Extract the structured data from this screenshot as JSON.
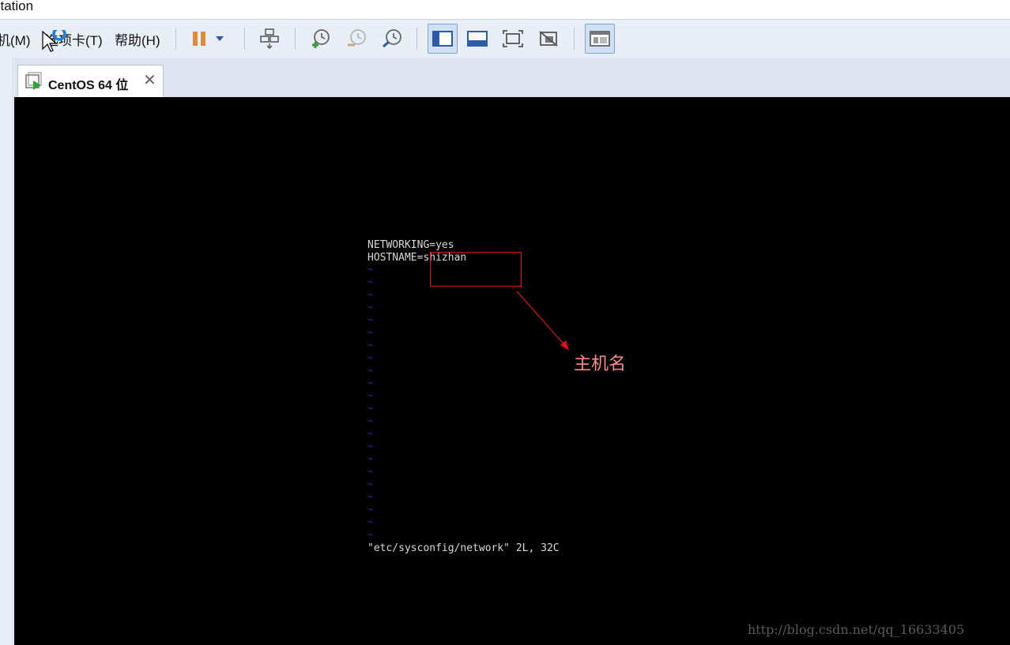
{
  "window": {
    "title": "station"
  },
  "menu": {
    "items": [
      {
        "label": "机(M)"
      },
      {
        "label": "选项卡(T)"
      },
      {
        "label": "帮助(H)"
      }
    ]
  },
  "toolbar": {
    "icons": [
      "pause-icon",
      "dropdown-arrow-icon",
      "send-ctrl-alt-del-icon",
      "snapshot-icon",
      "revert-snapshot-icon",
      "snapshot-manager-icon",
      "console-view-icon",
      "thumbnail-bar-icon",
      "fullscreen-icon",
      "unity-icon",
      "library-view-icon"
    ]
  },
  "tab": {
    "label": "CentOS 64 位",
    "close": "✕"
  },
  "terminal": {
    "lines": [
      "NETWORKING=yes",
      "HOSTNAME=shizhan"
    ],
    "status": "\"etc/sysconfig/network\" 2L, 32C",
    "tilde": "~"
  },
  "annotation": {
    "text": "主机名",
    "color": "#e01010"
  },
  "watermark": "http://blog.csdn.net/qq_16633405"
}
